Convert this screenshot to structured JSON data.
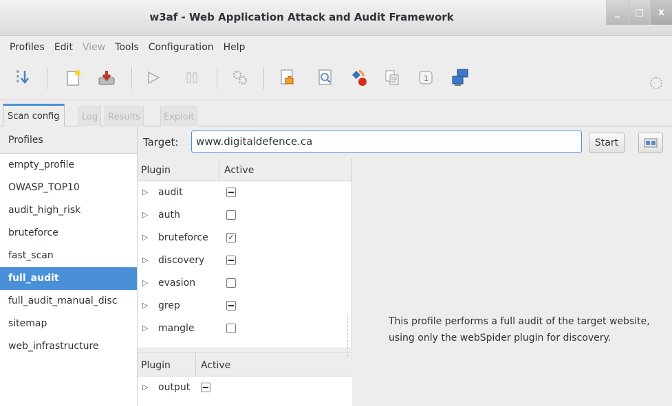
{
  "window": {
    "title": "w3af - Web Application Attack and Audit Framework",
    "minimize": "_",
    "maximize": "□",
    "close": "x"
  },
  "menu": {
    "items": [
      {
        "label": "Profiles",
        "enabled": true
      },
      {
        "label": "Edit",
        "enabled": true
      },
      {
        "label": "View",
        "enabled": false
      },
      {
        "label": "Tools",
        "enabled": true
      },
      {
        "label": "Configuration",
        "enabled": true
      },
      {
        "label": "Help",
        "enabled": true
      }
    ]
  },
  "toolbar": {
    "icons": [
      "wizard-icon",
      "new-profile-icon",
      "save-profile-icon",
      "play-icon",
      "pause-icon",
      "gears-icon",
      "manual-request-icon",
      "fuzzy-request-icon",
      "encode-decode-icon",
      "export-request-icon",
      "compare-icon",
      "proxy-icon"
    ]
  },
  "tabs": [
    {
      "label": "Scan config",
      "active": true
    },
    {
      "label": "Log",
      "active": false
    },
    {
      "label": "Results",
      "active": false
    },
    {
      "label": "Exploit",
      "active": false
    }
  ],
  "profiles": {
    "header": "Profiles",
    "items": [
      {
        "label": "empty_profile"
      },
      {
        "label": "OWASP_TOP10"
      },
      {
        "label": "audit_high_risk"
      },
      {
        "label": "bruteforce"
      },
      {
        "label": "fast_scan"
      },
      {
        "label": "full_audit",
        "selected": true
      },
      {
        "label": "full_audit_manual_disc"
      },
      {
        "label": "sitemap"
      },
      {
        "label": "web_infrastructure"
      }
    ]
  },
  "target": {
    "label": "Target:",
    "value": "www.digitaldefence.ca",
    "start_label": "Start"
  },
  "plugin_tree": {
    "col_plugin": "Plugin",
    "col_active": "Active",
    "rows": [
      {
        "name": "audit",
        "state": "mixed"
      },
      {
        "name": "auth",
        "state": "unchecked"
      },
      {
        "name": "bruteforce",
        "state": "checked"
      },
      {
        "name": "discovery",
        "state": "mixed"
      },
      {
        "name": "evasion",
        "state": "unchecked"
      },
      {
        "name": "grep",
        "state": "mixed"
      },
      {
        "name": "mangle",
        "state": "unchecked"
      }
    ]
  },
  "output_tree": {
    "col_plugin": "Plugin",
    "col_active": "Active",
    "rows": [
      {
        "name": "output",
        "state": "mixed"
      }
    ]
  },
  "description": "This profile performs a full audit of the target website, using only the webSpider plugin for discovery.",
  "colors": {
    "accent": "#4a90d9",
    "background": "#ededed"
  }
}
